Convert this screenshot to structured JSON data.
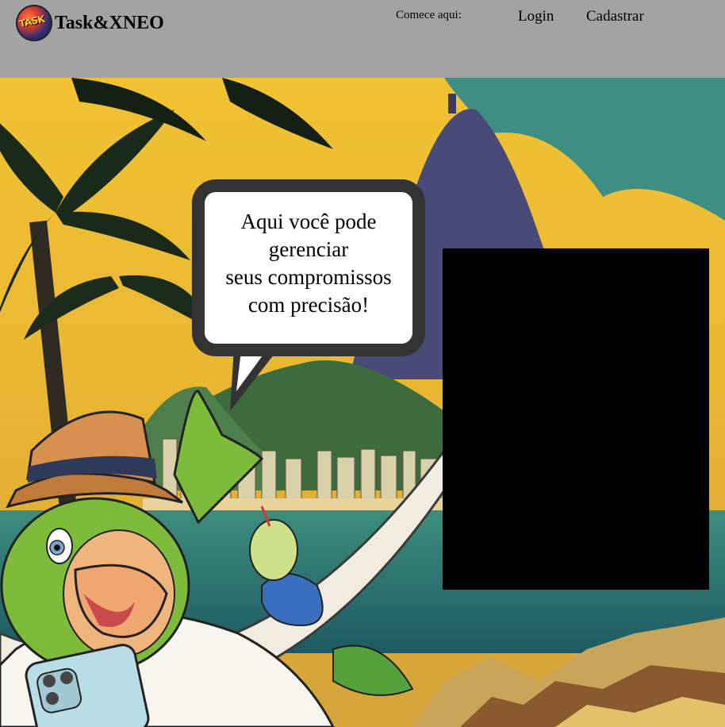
{
  "header": {
    "brand": "Task&XNEO",
    "logo_text": "TASK",
    "start_label": "Comece aqui:",
    "nav": {
      "login": "Login",
      "signup": "Cadastrar"
    }
  },
  "hero": {
    "speech_lines": [
      "Aqui você pode",
      "gerenciar",
      "seus compromissos",
      "com precisão!"
    ]
  },
  "colors": {
    "header_bg": "#a3a3a3",
    "bubble_border": "#333333",
    "panel": "#000000"
  }
}
